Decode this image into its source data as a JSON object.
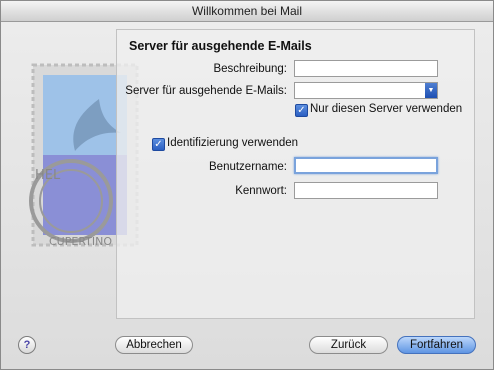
{
  "window": {
    "title": "Willkommen bei Mail"
  },
  "stamp": {
    "text_top": "HEL",
    "text_bottom": "CUPERTINO"
  },
  "form": {
    "heading": "Server für ausgehende E-Mails",
    "description_label": "Beschreibung:",
    "description_value": "",
    "server_label": "Server für ausgehende E-Mails:",
    "server_value": "",
    "only_this_server_label": "Nur diesen Server verwenden",
    "only_this_server_checked": true,
    "auth_label": "Identifizierung verwenden",
    "auth_checked": true,
    "username_label": "Benutzername:",
    "username_value": "",
    "password_label": "Kennwort:",
    "password_value": ""
  },
  "buttons": {
    "help": "?",
    "cancel": "Abbrechen",
    "back": "Zurück",
    "continue": "Fortfahren"
  },
  "colors": {
    "accent": "#5f95e3",
    "focus_ring": "#7aa3dc"
  }
}
